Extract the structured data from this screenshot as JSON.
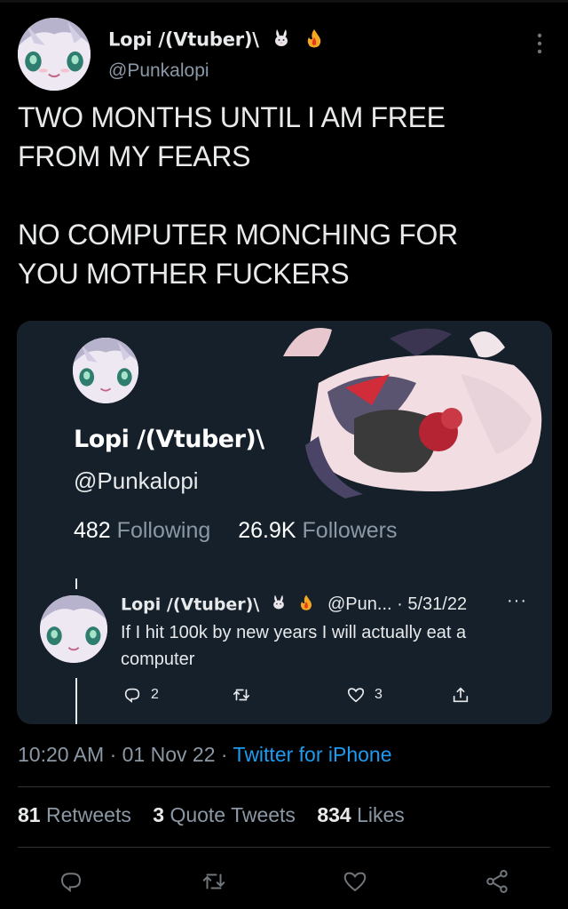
{
  "tweet": {
    "author_name": "Lopi /(Vtuber)\\",
    "author_handle": "@Punkalopi",
    "author_emojis": [
      "rabbit-emoji",
      "fire-emoji"
    ],
    "text": "TWO MONTHS UNTIL I AM FREE\nFROM MY FEARS\n\nNO COMPUTER MONCHING FOR\nYOU MOTHER FUCKERS",
    "time": "10:20 AM",
    "date": "01 Nov 22",
    "source": "Twitter for iPhone",
    "separator": "·",
    "retweets_count": "81",
    "retweets_label": "Retweets",
    "quotes_count": "3",
    "quotes_label": "Quote Tweets",
    "likes_count": "834",
    "likes_label": "Likes"
  },
  "profile_card": {
    "name": "Lopi /(Vtuber)\\",
    "handle": "@Punkalopi",
    "following_count": "482",
    "following_label": "Following",
    "followers_count": "26.9K",
    "followers_label": "Followers"
  },
  "embedded_reply": {
    "name": "Lopi /(Vtuber)\\",
    "meta": "@Pun... · 5/31/22",
    "more": "···",
    "text": "If I hit 100k by new years I will actually eat a computer",
    "reply_count": "2",
    "like_count": "3"
  },
  "colors": {
    "background": "#000000",
    "card": "#15202b",
    "secondary_text": "#8b98a5",
    "link": "#1d9bf0"
  },
  "icons": [
    "more-vertical-icon",
    "reply-icon",
    "retweet-icon",
    "like-icon",
    "share-icon"
  ]
}
